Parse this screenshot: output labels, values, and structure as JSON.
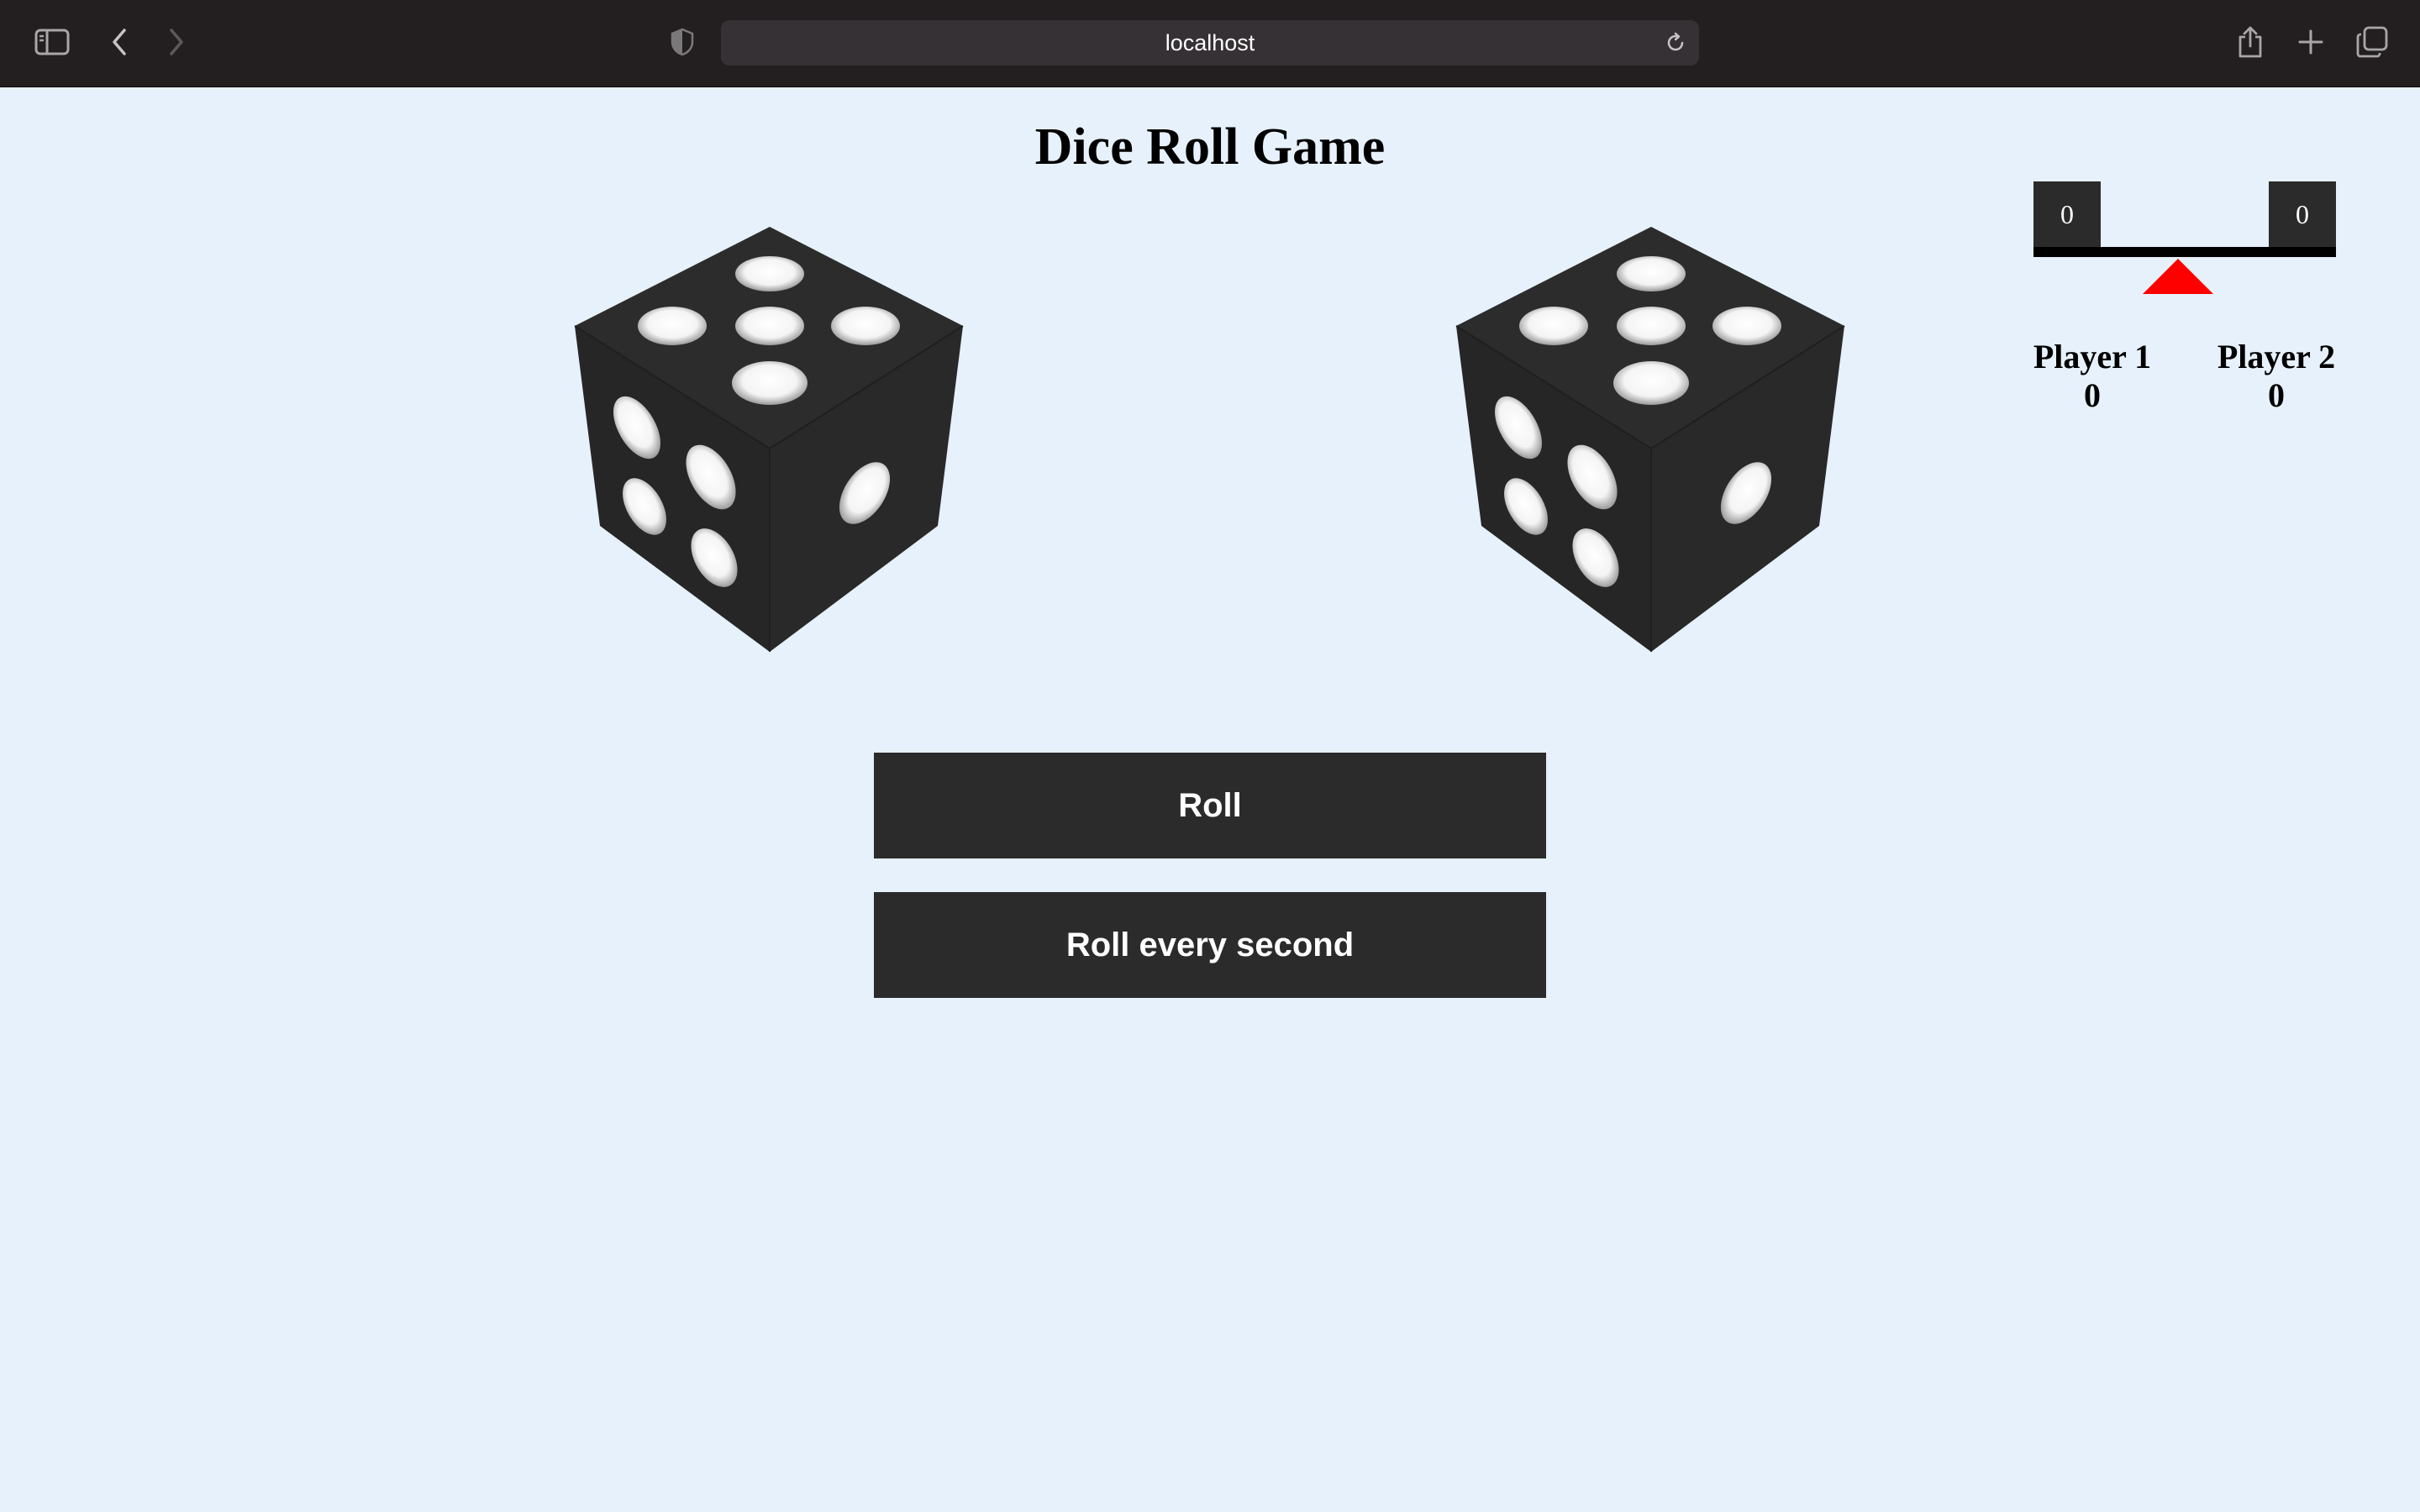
{
  "browser": {
    "url": "localhost",
    "icons": [
      "sidebar-icon",
      "back-icon",
      "forward-icon",
      "shield-icon",
      "reload-icon",
      "share-icon",
      "new-tab-icon",
      "tabs-overview-icon"
    ]
  },
  "game": {
    "title": "Dice Roll Game",
    "dice": [
      {
        "top_face": 5,
        "left_face": 4,
        "right_face": 1
      },
      {
        "top_face": 5,
        "left_face": 4,
        "right_face": 1
      }
    ],
    "roll_label": "Roll",
    "roll_every_label": "Roll every second"
  },
  "scale": {
    "left_value": "0",
    "right_value": "0",
    "fulcrum_color": "#ff0000"
  },
  "players": [
    {
      "name": "Player 1",
      "score": "0"
    },
    {
      "name": "Player 2",
      "score": "0"
    }
  ]
}
